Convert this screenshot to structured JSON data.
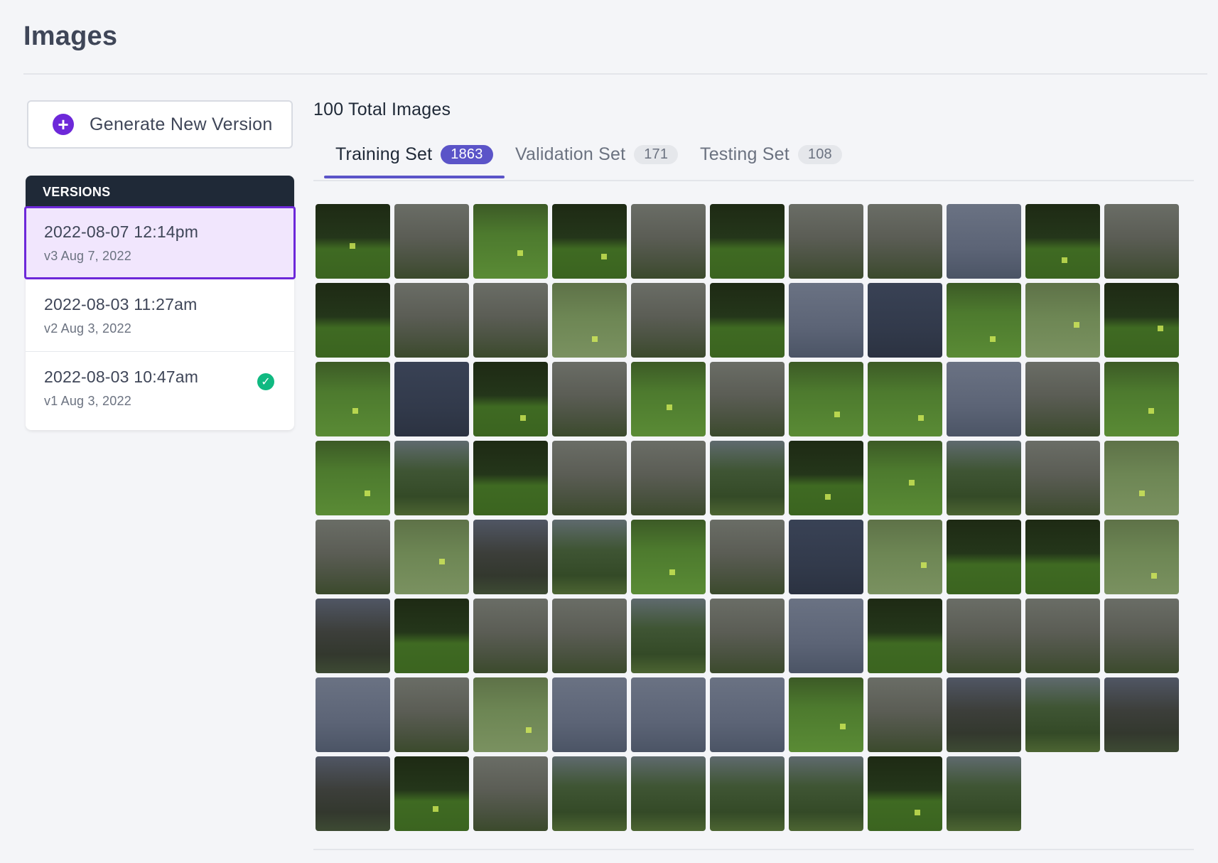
{
  "page": {
    "title": "Images"
  },
  "generate_button": {
    "label": "Generate New Version",
    "icon": "plus-circle-icon"
  },
  "versions": {
    "header": "VERSIONS",
    "items": [
      {
        "title": "2022-08-07 12:14pm",
        "subtitle": "v3 Aug 7, 2022",
        "selected": true,
        "check": false
      },
      {
        "title": "2022-08-03 11:27am",
        "subtitle": "v2 Aug 3, 2022",
        "selected": false,
        "check": false
      },
      {
        "title": "2022-08-03 10:47am",
        "subtitle": "v1 Aug 3, 2022",
        "selected": false,
        "check": true
      }
    ]
  },
  "summary": {
    "total_label": "100 Total Images"
  },
  "tabs": [
    {
      "label": "Training Set",
      "count": "1863",
      "active": true
    },
    {
      "label": "Validation Set",
      "count": "171",
      "active": false
    },
    {
      "label": "Testing Set",
      "count": "108",
      "active": false
    }
  ],
  "colors": {
    "accent": "#6d28d9",
    "tab_active": "#5b54c8",
    "success": "#10b981",
    "versions_header": "#1f2937"
  },
  "thumbnails": [
    "green-dark",
    "palms",
    "green-mid",
    "green-dark",
    "palms",
    "green-dark",
    "palms",
    "palms",
    "sky",
    "green-dark",
    "palms",
    "green-dark",
    "palms",
    "palms",
    "green-light",
    "palms",
    "green-dark",
    "sky",
    "sky-dark",
    "green-mid",
    "green-light",
    "green-dark",
    "green-mid",
    "sky-dark",
    "green-dark",
    "palms",
    "green-mid",
    "palms",
    "green-mid",
    "green-mid",
    "sky",
    "palms",
    "green-mid",
    "green-mid",
    "trees",
    "green-dark",
    "palms",
    "palms",
    "trees",
    "green-dark",
    "green-mid",
    "trees",
    "palms",
    "green-light",
    "palms",
    "green-light",
    "mountain",
    "trees",
    "green-mid",
    "palms",
    "sky-dark",
    "green-light",
    "green-dark",
    "green-dark",
    "green-light",
    "mountain",
    "green-dark",
    "palms",
    "palms",
    "trees",
    "palms",
    "sky",
    "green-dark",
    "palms",
    "palms",
    "palms",
    "sky",
    "palms",
    "green-light",
    "sky",
    "sky",
    "sky",
    "green-mid",
    "palms",
    "mountain",
    "trees",
    "mountain",
    "mountain",
    "green-dark",
    "palms",
    "trees",
    "trees",
    "trees",
    "trees",
    "green-dark",
    "trees"
  ]
}
